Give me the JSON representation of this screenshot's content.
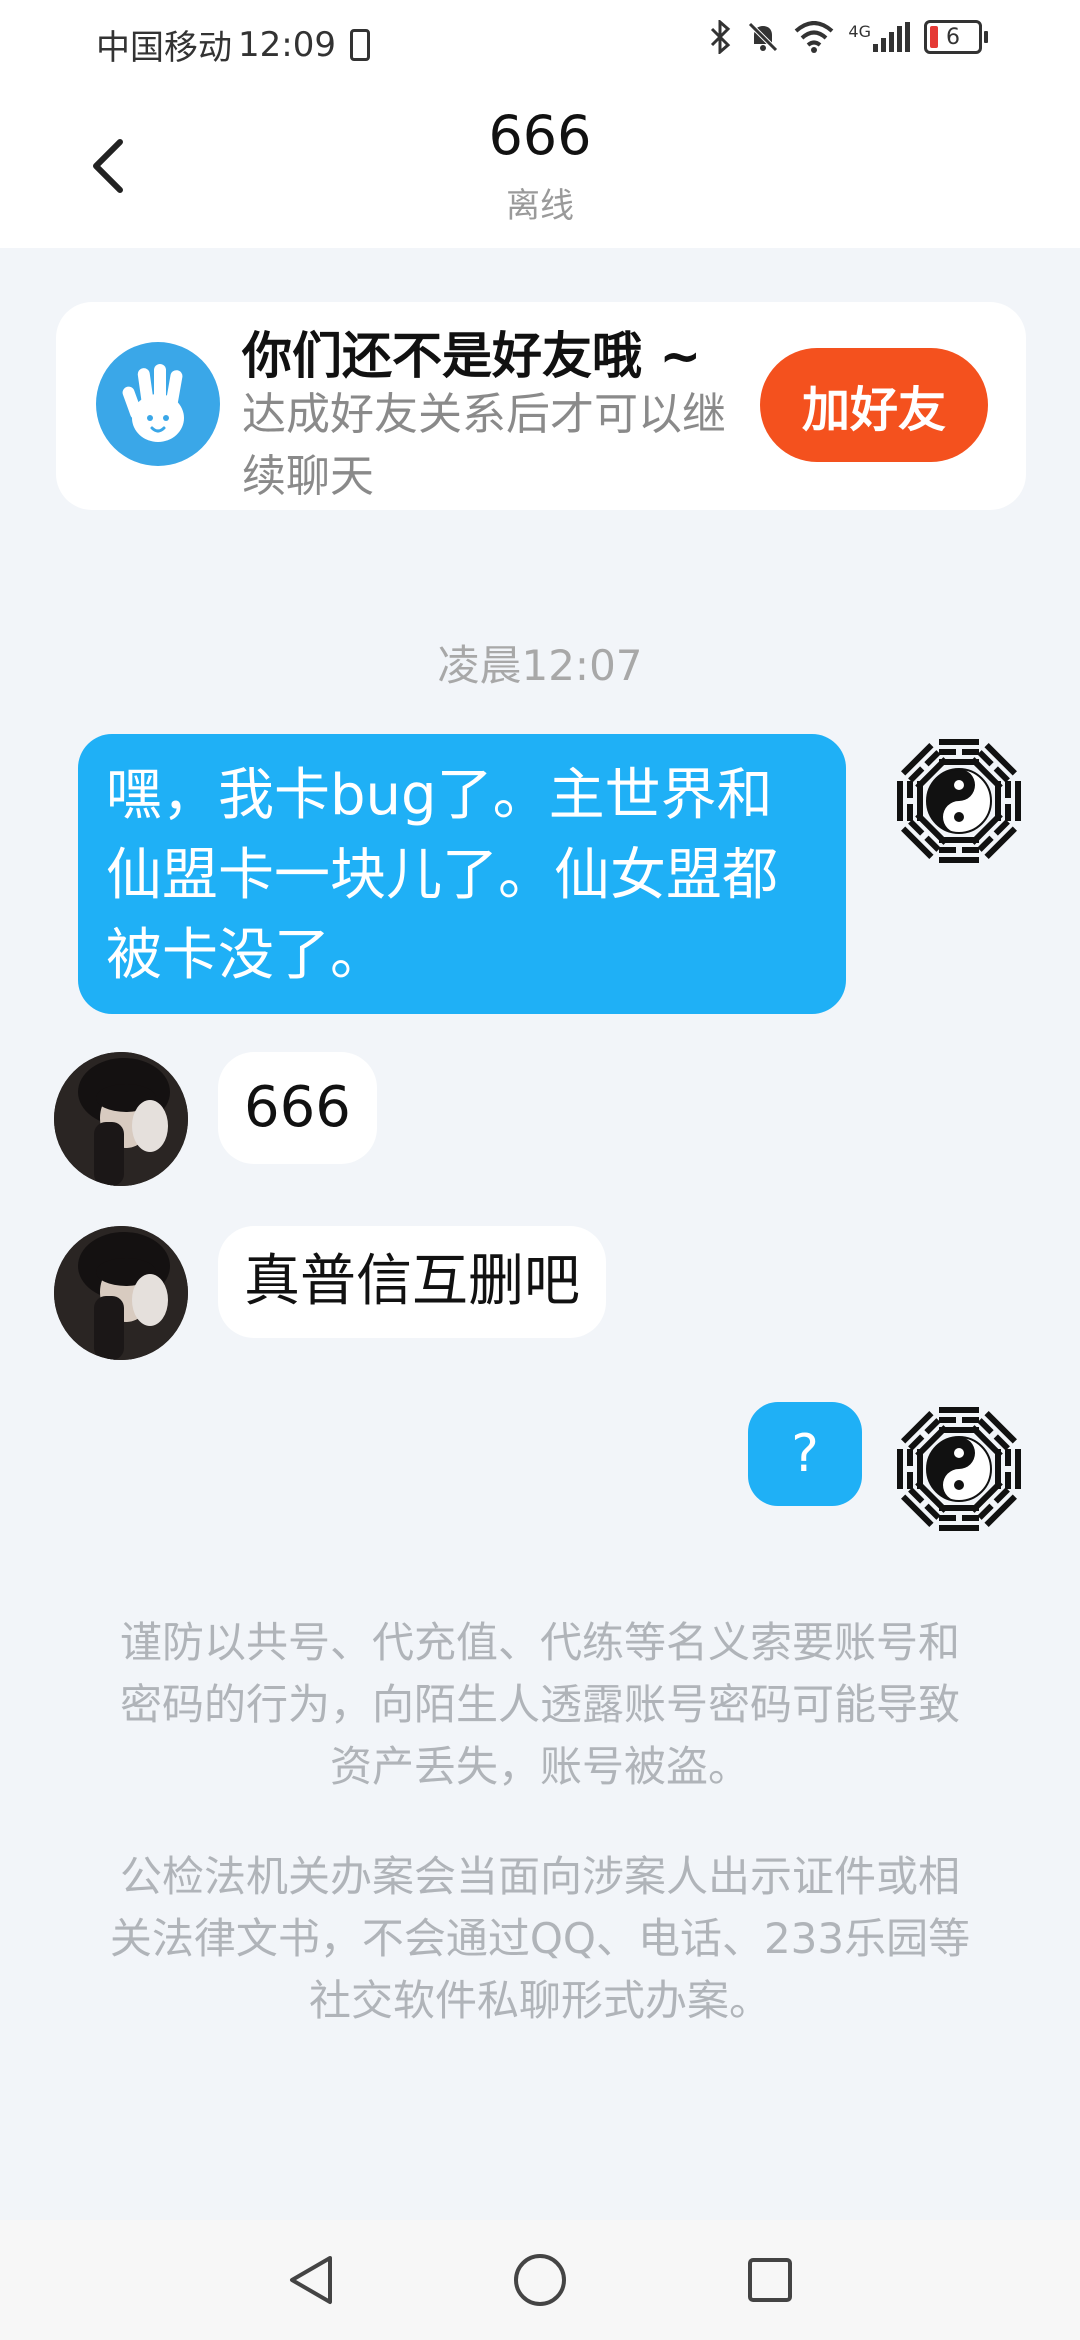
{
  "status_bar": {
    "carrier": "中国移动",
    "time": "12:09",
    "network": "4G",
    "battery": "6"
  },
  "header": {
    "title": "666",
    "subtitle": "离线"
  },
  "friend_banner": {
    "title": "你们还不是好友哦 ~",
    "description": "达成好友关系后才可以继续聊天",
    "add_button": "加好友"
  },
  "chat": {
    "timestamp": "凌晨12:07",
    "messages": [
      {
        "from": "me",
        "text": "嘿，我卡bug了。主世界和仙盟卡一块儿了。仙女盟都被卡没了。"
      },
      {
        "from": "other",
        "text": "666"
      },
      {
        "from": "other",
        "text": "真普信互删吧"
      },
      {
        "from": "me",
        "text": "?"
      }
    ]
  },
  "notices": [
    "谨防以共号、代充值、代练等名义索要账号和密码的行为，向陌生人透露账号密码可能导致资产丢失，账号被盗。",
    "公检法机关办案会当面向涉案人出示证件或相关法律文书，不会通过QQ、电话、233乐园等社交软件私聊形式办案。"
  ],
  "colors": {
    "accent_blue": "#1fb0f6",
    "add_button": "#f4511e",
    "background": "#f2f5f9"
  },
  "icons": {
    "back": "back-arrow-icon",
    "wave": "waving-hand-icon",
    "nav_back": "triangle-back-icon",
    "nav_home": "circle-home-icon",
    "nav_recents": "square-recents-icon"
  }
}
